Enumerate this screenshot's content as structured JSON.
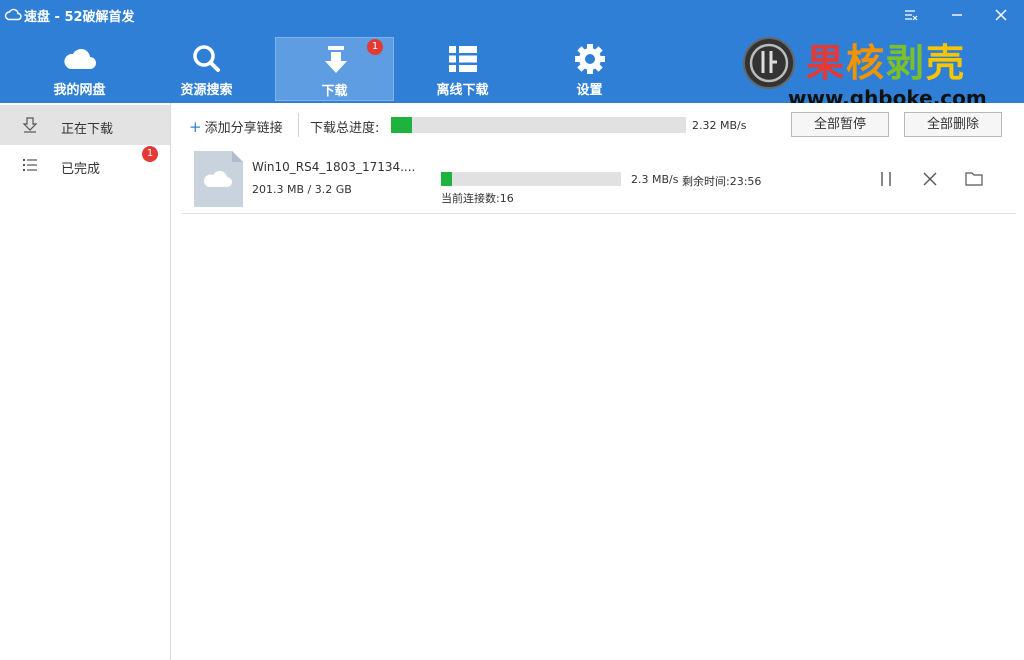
{
  "window": {
    "title": "速盘 - 52破解首发"
  },
  "nav": [
    {
      "label": "我的网盘",
      "icon": "cloud-icon"
    },
    {
      "label": "资源搜索",
      "icon": "search-icon"
    },
    {
      "label": "下载",
      "icon": "download-icon",
      "badge": "1",
      "active": true
    },
    {
      "label": "离线下载",
      "icon": "list-grid-icon"
    },
    {
      "label": "设置",
      "icon": "gear-icon"
    }
  ],
  "logo": {
    "text": "果核剥壳",
    "url": "www.ghboke.com"
  },
  "sidebar": {
    "items": [
      {
        "label": "正在下载",
        "icon": "download-tray-icon",
        "active": true
      },
      {
        "label": "已完成",
        "icon": "list-icon",
        "badge": "1"
      }
    ]
  },
  "toolbar": {
    "add_link_label": "添加分享链接",
    "progress_label": "下载总进度:",
    "total_progress": 0.07,
    "total_speed": "2.32 MB/s",
    "pause_all_label": "全部暂停",
    "delete_all_label": "全部删除"
  },
  "downloads": [
    {
      "name": "Win10_RS4_1803_17134....",
      "size": "201.3 MB / 3.2 GB",
      "progress": 0.06,
      "speed": "2.3 MB/s",
      "remaining": "剩余时间:23:56",
      "connections": "当前连接数:16"
    }
  ],
  "colors": {
    "header": "#2f7fd6",
    "progress": "#1db33d",
    "badge": "#e53935"
  }
}
